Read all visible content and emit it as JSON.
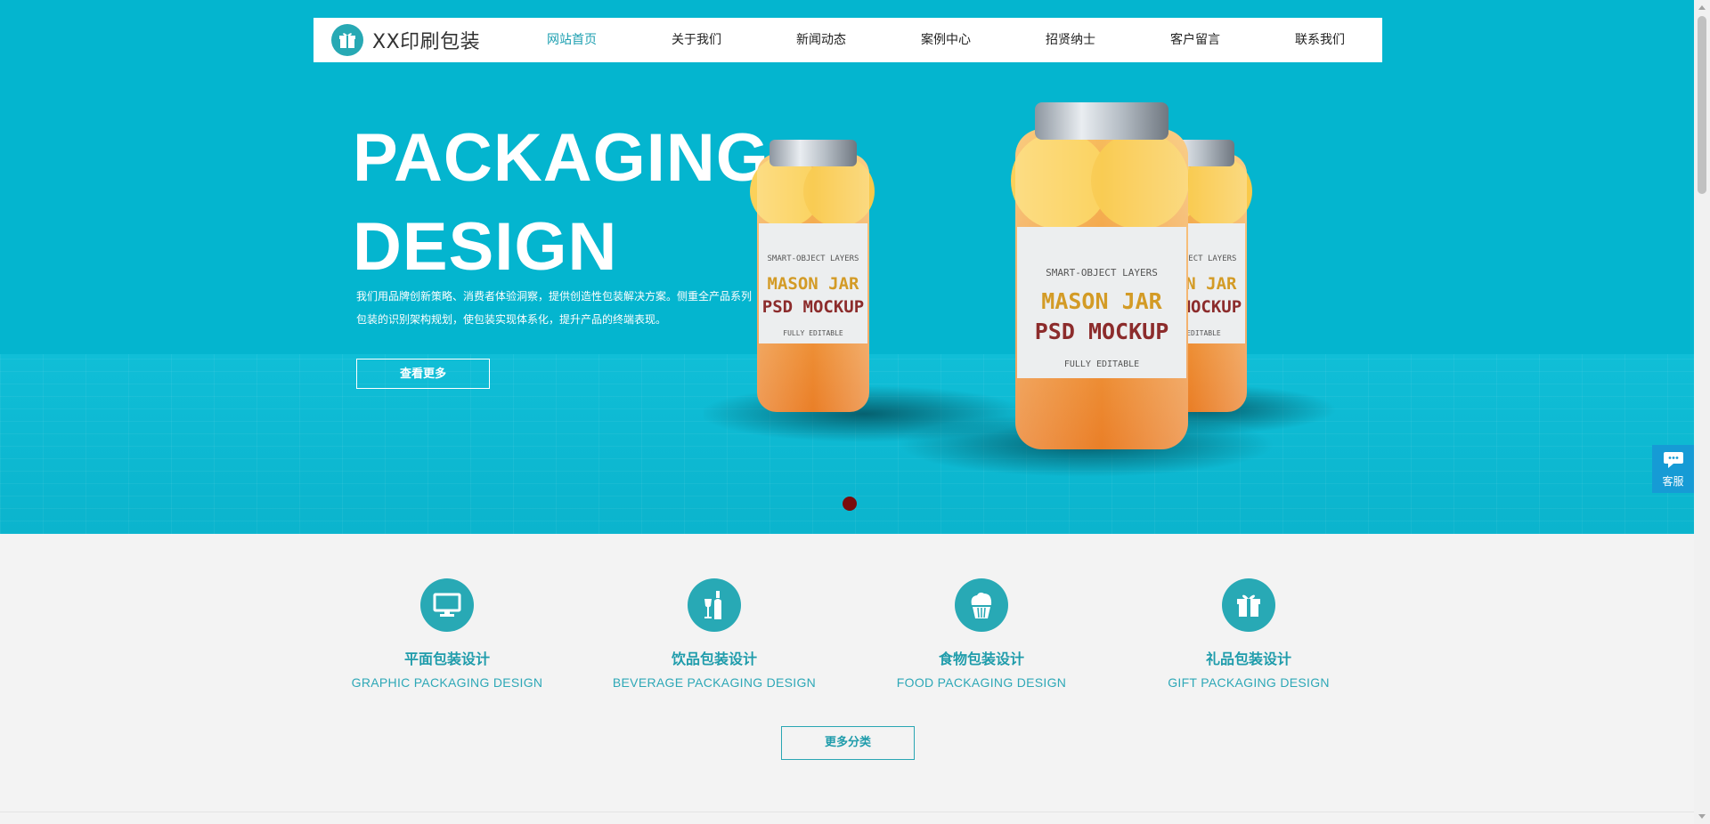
{
  "nav": {
    "logo_text": "XX印刷包装",
    "logo_icon": "gift-icon",
    "items": [
      {
        "label": "网站首页",
        "active": true
      },
      {
        "label": "关于我们",
        "active": false
      },
      {
        "label": "新闻动态",
        "active": false
      },
      {
        "label": "案例中心",
        "active": false
      },
      {
        "label": "招贤纳士",
        "active": false
      },
      {
        "label": "客户留言",
        "active": false
      },
      {
        "label": "联系我们",
        "active": false
      }
    ]
  },
  "hero": {
    "title_line1": "PACKAGING",
    "title_line2": "DESIGN",
    "description_line1": "我们用品牌创新策略、消费者体验洞察，提供创造性包装解决方案。侧重全产品系列",
    "description_line2": "包装的识别架构规划，使包装实现体系化，提升产品的终端表现。",
    "button_label": "查看更多",
    "image": {
      "label_top": "SMART-OBJECT LAYERS",
      "label_line1": "MASON JAR",
      "label_line2": "PSD MOCKUP",
      "label_bottom": "FULLY EDITABLE"
    },
    "slide_count": 1,
    "active_slide": 1
  },
  "services": [
    {
      "icon": "monitor-icon",
      "title": "平面包装设计",
      "subtitle": "GRAPHIC PACKAGING DESIGN"
    },
    {
      "icon": "bottle-icon",
      "title": "饮品包装设计",
      "subtitle": "BEVERAGE PACKAGING DESIGN"
    },
    {
      "icon": "cupcake-icon",
      "title": "食物包装设计",
      "subtitle": "FOOD PACKAGING DESIGN"
    },
    {
      "icon": "gift-icon",
      "title": "礼品包装设计",
      "subtitle": "GIFT PACKAGING DESIGN"
    }
  ],
  "more_button_label": "更多分类",
  "chat_widget": {
    "label": "客服",
    "icon": "chat-bubble-icon"
  },
  "colors": {
    "hero_bg": "#04b5cf",
    "accent": "#28a9b5",
    "accent_text": "#1f9cab",
    "page_bg": "#f3f3f3",
    "slider_dot": "#7a0c0c",
    "chat_bg": "#169bd5"
  }
}
